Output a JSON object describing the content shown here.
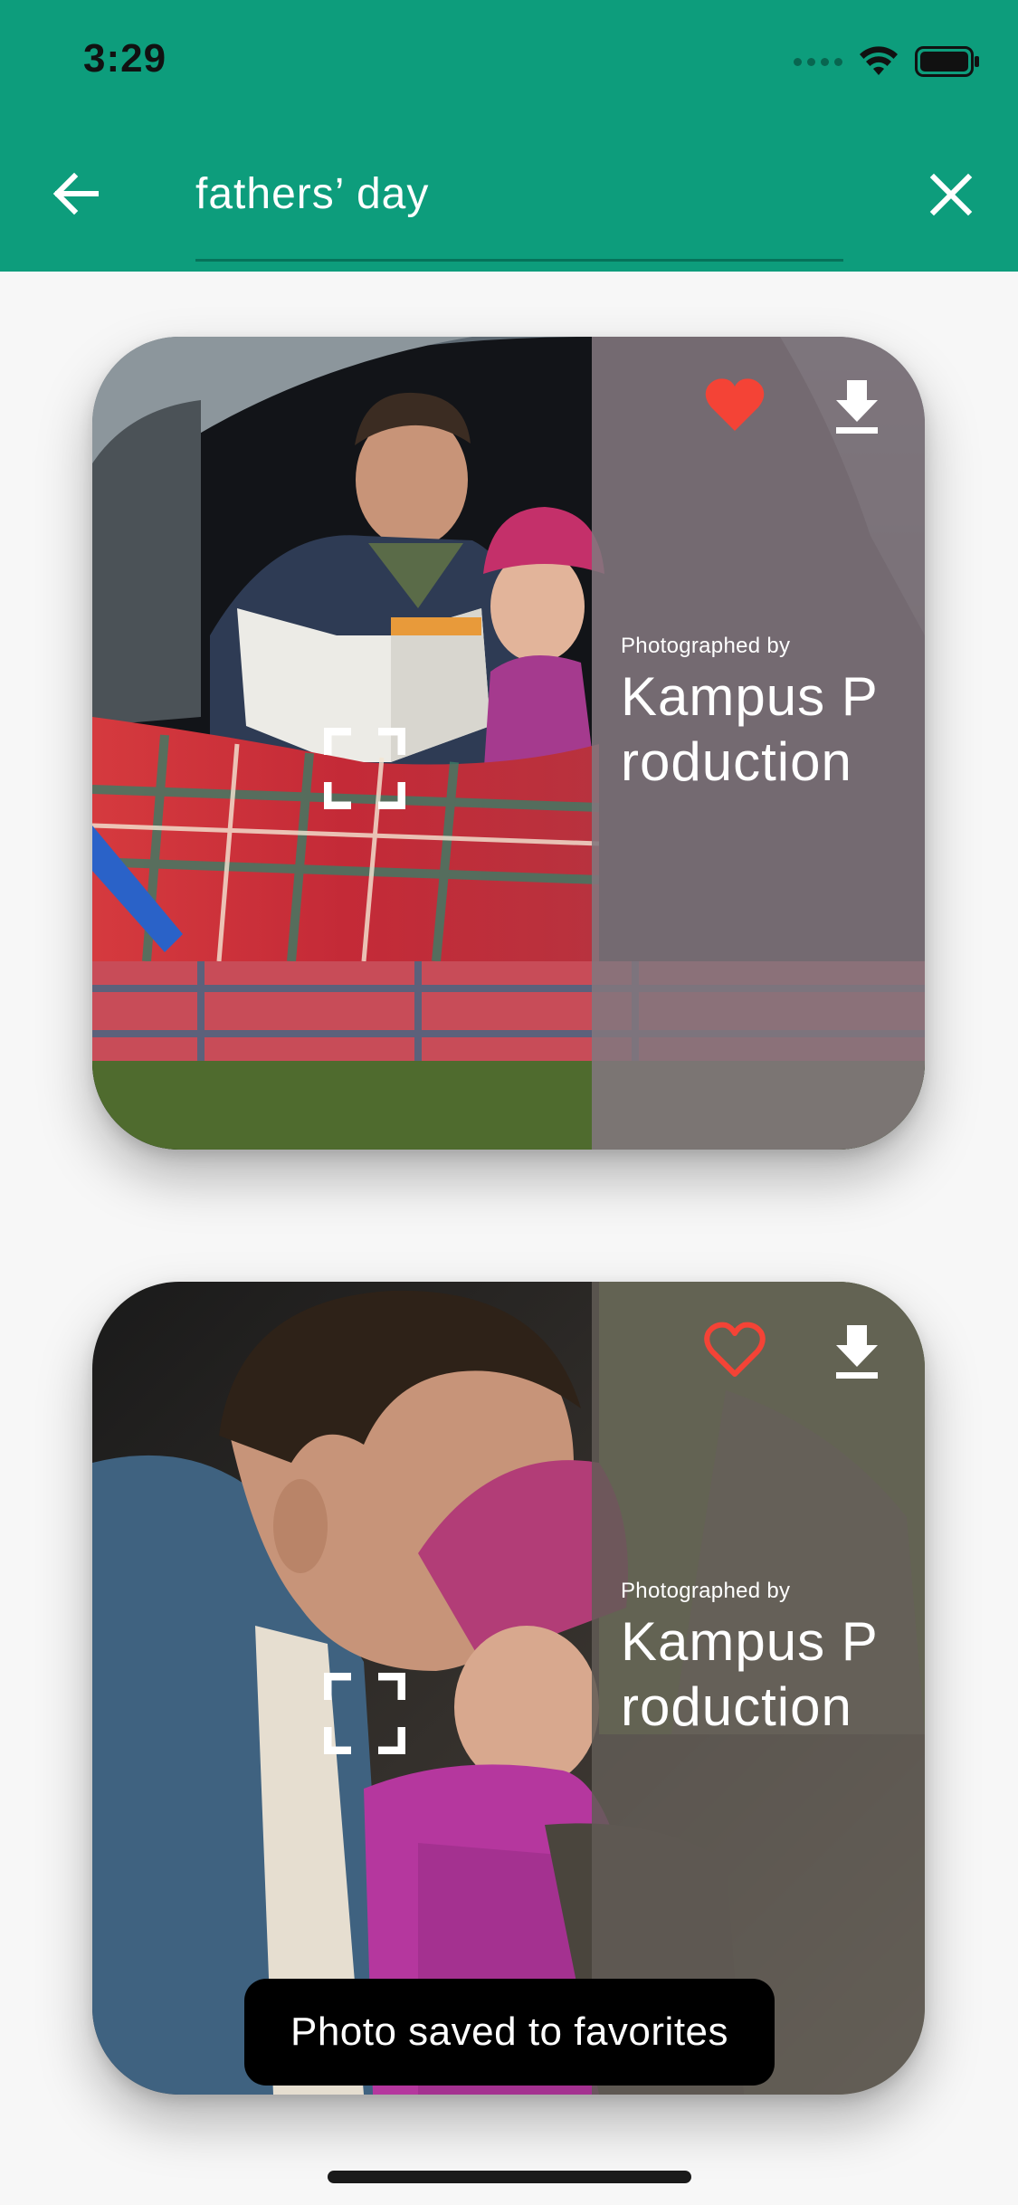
{
  "status_bar": {
    "time": "3:29",
    "icons": [
      "signal-dots-icon",
      "wifi-icon",
      "battery-icon"
    ]
  },
  "app_bar": {
    "background_color": "#0d9d7c",
    "back_icon": "arrow-left-icon",
    "search": {
      "value": "fathers’ day",
      "placeholder": ""
    },
    "clear_icon": "close-icon"
  },
  "results": [
    {
      "credit_prefix": "Photographed by",
      "photographer": "Kampus Production",
      "favorited": true,
      "icons": [
        "heart-filled-icon",
        "download-icon",
        "expand-icon"
      ]
    },
    {
      "credit_prefix": "Photographed by",
      "photographer": "Kampus Production",
      "favorited": false,
      "icons": [
        "heart-outline-icon",
        "download-icon",
        "expand-icon"
      ]
    }
  ],
  "snackbar": {
    "message": "Photo saved to favorites"
  },
  "colors": {
    "favorite": "#f44336",
    "overlay_text": "#ffffff"
  }
}
